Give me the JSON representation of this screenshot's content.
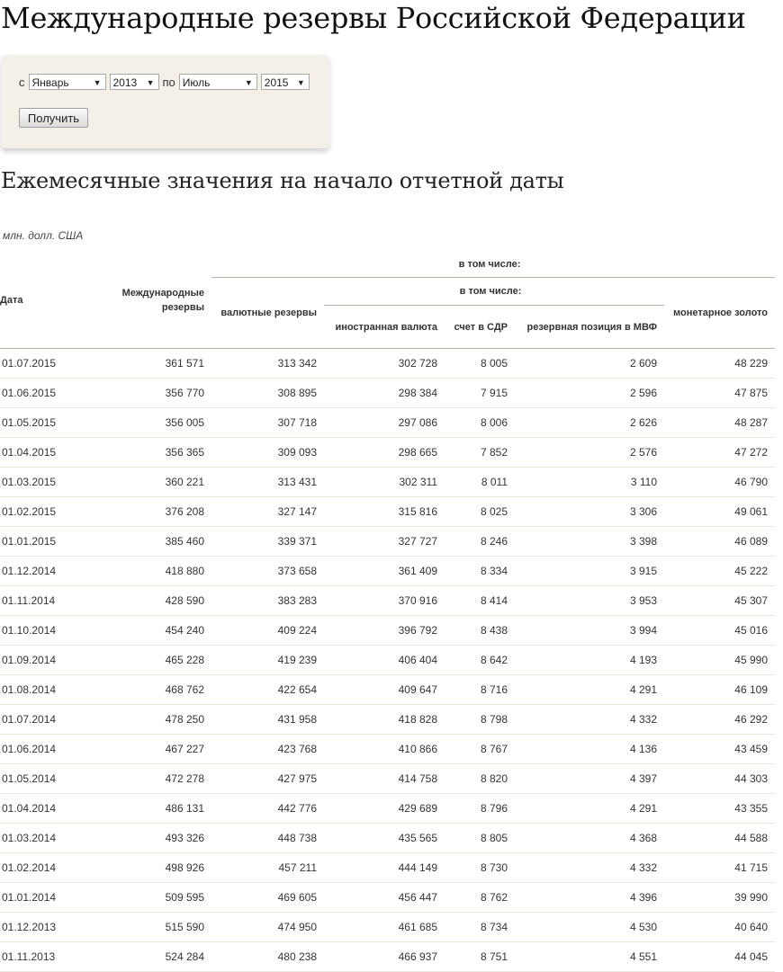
{
  "page": {
    "title": "Международные резервы Российской Федерации",
    "subtitle": "Ежемесячные значения на начало отчетной даты",
    "units": "млн. долл. США"
  },
  "filter": {
    "from_label": "с",
    "to_label": "по",
    "from_month": "Январь",
    "from_year": "2013",
    "to_month": "Июль",
    "to_year": "2015",
    "submit_label": "Получить"
  },
  "table": {
    "headers": {
      "date": "Дата",
      "total": "Международные резервы",
      "including": "в том числе:",
      "fx_reserves": "валютные резервы",
      "including_sub": "в том числе:",
      "foreign_currency": "иностранная валюта",
      "sdr": "счет в СДР",
      "imf_position": "резервная позиция в МВФ",
      "gold": "монетарное золото"
    },
    "rows": [
      [
        "01.07.2015",
        "361 571",
        "313 342",
        "302 728",
        "8 005",
        "2 609",
        "48 229"
      ],
      [
        "01.06.2015",
        "356 770",
        "308 895",
        "298 384",
        "7 915",
        "2 596",
        "47 875"
      ],
      [
        "01.05.2015",
        "356 005",
        "307 718",
        "297 086",
        "8 006",
        "2 626",
        "48 287"
      ],
      [
        "01.04.2015",
        "356 365",
        "309 093",
        "298 665",
        "7 852",
        "2 576",
        "47 272"
      ],
      [
        "01.03.2015",
        "360 221",
        "313 431",
        "302 311",
        "8 011",
        "3 110",
        "46 790"
      ],
      [
        "01.02.2015",
        "376 208",
        "327 147",
        "315 816",
        "8 025",
        "3 306",
        "49 061"
      ],
      [
        "01.01.2015",
        "385 460",
        "339 371",
        "327 727",
        "8 246",
        "3 398",
        "46 089"
      ],
      [
        "01.12.2014",
        "418 880",
        "373 658",
        "361 409",
        "8 334",
        "3 915",
        "45 222"
      ],
      [
        "01.11.2014",
        "428 590",
        "383 283",
        "370 916",
        "8 414",
        "3 953",
        "45 307"
      ],
      [
        "01.10.2014",
        "454 240",
        "409 224",
        "396 792",
        "8 438",
        "3 994",
        "45 016"
      ],
      [
        "01.09.2014",
        "465 228",
        "419 239",
        "406 404",
        "8 642",
        "4 193",
        "45 990"
      ],
      [
        "01.08.2014",
        "468 762",
        "422 654",
        "409 647",
        "8 716",
        "4 291",
        "46 109"
      ],
      [
        "01.07.2014",
        "478 250",
        "431 958",
        "418 828",
        "8 798",
        "4 332",
        "46 292"
      ],
      [
        "01.06.2014",
        "467 227",
        "423 768",
        "410 866",
        "8 767",
        "4 136",
        "43 459"
      ],
      [
        "01.05.2014",
        "472 278",
        "427 975",
        "414 758",
        "8 820",
        "4 397",
        "44 303"
      ],
      [
        "01.04.2014",
        "486 131",
        "442 776",
        "429 689",
        "8 796",
        "4 291",
        "43 355"
      ],
      [
        "01.03.2014",
        "493 326",
        "448 738",
        "435 565",
        "8 805",
        "4 368",
        "44 588"
      ],
      [
        "01.02.2014",
        "498 926",
        "457 211",
        "444 149",
        "8 730",
        "4 332",
        "41 715"
      ],
      [
        "01.01.2014",
        "509 595",
        "469 605",
        "456 447",
        "8 762",
        "4 396",
        "39 990"
      ],
      [
        "01.12.2013",
        "515 590",
        "474 950",
        "461 685",
        "8 734",
        "4 530",
        "40 640"
      ],
      [
        "01.11.2013",
        "524 284",
        "480 238",
        "466 937",
        "8 751",
        "4 551",
        "44 045"
      ]
    ]
  }
}
